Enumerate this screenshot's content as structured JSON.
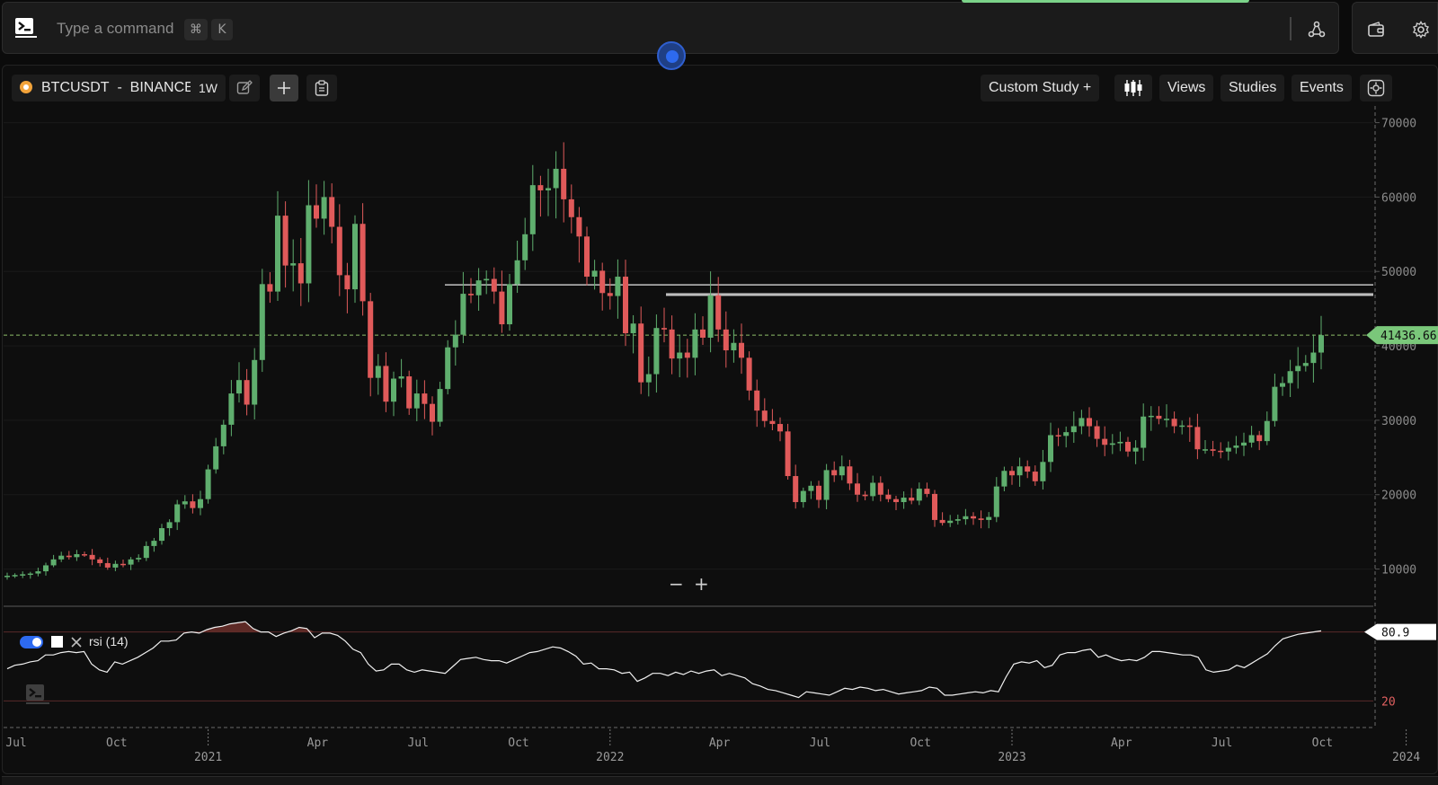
{
  "command_bar": {
    "placeholder": "Type a command",
    "shortcut_cmd": "⌘",
    "shortcut_key": "K"
  },
  "toolbar": {
    "symbol": "BTCUSDT",
    "separator": "-",
    "exchange": "BINANCE",
    "interval": "1W",
    "custom_study": "Custom Study +",
    "views": "Views",
    "studies": "Studies",
    "events": "Events"
  },
  "zoom": {
    "minus": "−",
    "plus": "+"
  },
  "rsi": {
    "label": "rsi (14)"
  },
  "colors": {
    "up": "#5fae6e",
    "down": "#e05a5a",
    "accent": "#2d6af0",
    "price_tag": "#7ac77a",
    "background": "#0e0e0e"
  },
  "icons": [
    "terminal-icon",
    "share-icon",
    "wallet-icon",
    "gear-icon",
    "pencil-icon",
    "plus-icon",
    "clipboard-icon",
    "candlestick-icon",
    "settings-icon",
    "close-icon"
  ],
  "chart_data": [
    {
      "type": "candlestick",
      "title": "",
      "interval": "1W",
      "ylim": [
        5000,
        72000
      ],
      "yticks": [
        10000,
        20000,
        30000,
        40000,
        50000,
        60000,
        70000
      ],
      "ytick_labels": [
        "10000",
        "20000",
        "30000",
        "40000",
        "50000",
        "60000",
        "70000"
      ],
      "xtick_labels": [
        "Jul",
        "Oct",
        "2021",
        "Apr",
        "Jul",
        "Oct",
        "2022",
        "Apr",
        "Jul",
        "Oct",
        "2023",
        "Apr",
        "Jul",
        "Oct",
        "2024"
      ],
      "last_price": "41436.66",
      "last_price_value": 41436.66,
      "horizontal_lines": [
        48200,
        47000,
        46800
      ],
      "series": [
        {
          "name": "BTCUSDT",
          "close": [
            9100,
            9200,
            9300,
            9400,
            9700,
            10500,
            11300,
            11800,
            11600,
            12000,
            11900,
            11300,
            10800,
            10200,
            10700,
            10600,
            11300,
            11500,
            13100,
            13800,
            15500,
            16300,
            18700,
            19100,
            18200,
            19400,
            23400,
            26500,
            29400,
            33600,
            35400,
            32100,
            38100,
            48300,
            47300,
            57500,
            50800,
            51100,
            48400,
            58900,
            57100,
            60000,
            56000,
            49500,
            47600,
            56400,
            46000,
            35700,
            37300,
            32500,
            35600,
            35900,
            31600,
            33600,
            32200,
            29800,
            34200,
            39800,
            41500,
            47000,
            46800,
            48800,
            49000,
            47300,
            42900,
            48300,
            51500,
            55000,
            61600,
            60900,
            61200,
            63800,
            59700,
            57300,
            54700,
            49300,
            50100,
            47100,
            46700,
            49300,
            41700,
            43000,
            35100,
            36200,
            42400,
            42200,
            38300,
            39100,
            38400,
            42200,
            41100,
            46800,
            42200,
            39400,
            40400,
            38400,
            34000,
            31300,
            29900,
            29500,
            28500,
            22500,
            19000,
            20500,
            21200,
            19300,
            23300,
            22600,
            23800,
            21500,
            20000,
            19800,
            21600,
            20000,
            19400,
            19000,
            19600,
            19200,
            20800,
            20100,
            16600,
            16200,
            16500,
            16700,
            17100,
            16800,
            16600,
            17000,
            21100,
            23200,
            22600,
            23800,
            23100,
            21800,
            24400,
            28000,
            27900,
            28400,
            29200,
            30300,
            29200,
            27500,
            26700,
            26900,
            27100,
            25800,
            26300,
            30500,
            30600,
            30200,
            30200,
            29200,
            29300,
            29100,
            26100,
            26100,
            25900,
            25800,
            26300,
            26600,
            27000,
            28000,
            27200,
            29900,
            34500,
            35000,
            36600,
            37300,
            37700,
            39100,
            41436.66
          ]
        }
      ]
    },
    {
      "type": "line",
      "title": "rsi (14)",
      "ylim": [
        0,
        100
      ],
      "levels": [
        20,
        80
      ],
      "level_labels": [
        "20",
        "80"
      ],
      "last_value": "80.9",
      "series": [
        {
          "name": "rsi (14)",
          "values": [
            48,
            51,
            52,
            54,
            55,
            60,
            60,
            62,
            63,
            62,
            63,
            52,
            47,
            45,
            54,
            52,
            55,
            58,
            62,
            66,
            72,
            72,
            73,
            79,
            80,
            79,
            82,
            84,
            85,
            87,
            88,
            89,
            83,
            80,
            80,
            76,
            79,
            81,
            84,
            83,
            75,
            79,
            79,
            77,
            72,
            65,
            62,
            52,
            46,
            47,
            52,
            52,
            47,
            45,
            47,
            46,
            45,
            44,
            50,
            56,
            57,
            58,
            56,
            55,
            55,
            53,
            56,
            59,
            62,
            63,
            65,
            67,
            66,
            63,
            59,
            52,
            53,
            48,
            48,
            47,
            44,
            45,
            37,
            40,
            44,
            44,
            42,
            45,
            43,
            46,
            44,
            46,
            47,
            42,
            44,
            42,
            40,
            35,
            33,
            30,
            29,
            27,
            25,
            23,
            28,
            27,
            26,
            25,
            28,
            31,
            30,
            32,
            31,
            29,
            30,
            28,
            26,
            27,
            28,
            29,
            32,
            31,
            25,
            25,
            26,
            27,
            28,
            27,
            29,
            28,
            41,
            52,
            54,
            53,
            55,
            49,
            51,
            60,
            62,
            62,
            64,
            65,
            58,
            60,
            57,
            55,
            56,
            55,
            58,
            63,
            63,
            62,
            61,
            60,
            60,
            58,
            47,
            45,
            46,
            47,
            51,
            49,
            53,
            57,
            61,
            68,
            74,
            76,
            78,
            79,
            80,
            80.9
          ]
        }
      ]
    }
  ]
}
